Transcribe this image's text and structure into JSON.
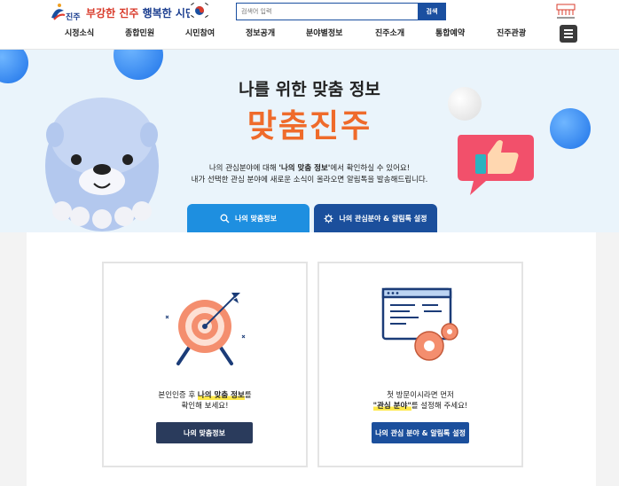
{
  "header": {
    "logo_text": "진주",
    "slogan_part1": "부강한 진주",
    "slogan_part2": "행복한 시민",
    "search_placeholder": "검색어 입력",
    "search_button": "검색"
  },
  "nav": {
    "items": [
      "시정소식",
      "종합민원",
      "시민참여",
      "정보공개",
      "분야별정보",
      "진주소개",
      "통합예약",
      "진주관광"
    ]
  },
  "hero": {
    "title": "나를 위한 맞춤 정보",
    "brand": "맞춤진주",
    "desc_line1_pre": "나의 관심분야에 대해 ",
    "desc_line1_bold": "'나의 맞춤 정보'",
    "desc_line1_post": "에서 확인하실 수 있어요!",
    "desc_line2": "내가 선택한 관심 분야에 새로운 소식이 올라오면 알림톡을 발송해드립니다.",
    "tab1_label": "나의 맞춤정보",
    "tab2_label": "나의 관심분야 & 알림톡 설정"
  },
  "cards": {
    "card1": {
      "text_pre": "본인인증 후 ",
      "text_hl": "나의 맞춤 정보",
      "text_post": "를",
      "text_line2": "확인해 보세요!",
      "button": "나의 맞춤정보"
    },
    "card2": {
      "text_line1": "첫 방문이시라면 먼저",
      "text_hl": "\"관심 분야\"",
      "text_post": "를 설정해 주세요!",
      "button": "나의 관심 분야 & 알림톡 설정"
    }
  },
  "colors": {
    "accent_orange": "#ef6b2b",
    "primary_blue": "#1b4f9c",
    "tab_blue": "#1e8fe0",
    "hero_bg": "#eaf4fb"
  }
}
